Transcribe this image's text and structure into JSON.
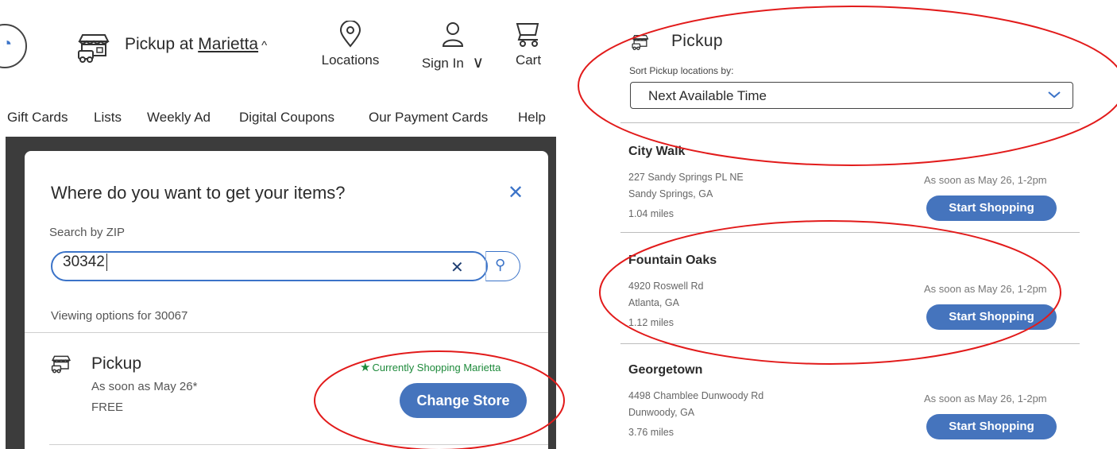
{
  "header": {
    "pickup_prefix": "Pickup at ",
    "pickup_location": "Marietta",
    "caret": "^",
    "locations_label": "Locations",
    "signin_label": "Sign In",
    "signin_caret": "∨",
    "cart_label": "Cart"
  },
  "nav": {
    "items": [
      "Gift Cards",
      "Lists",
      "Weekly Ad",
      "Digital Coupons",
      "Our Payment Cards",
      "Help"
    ]
  },
  "modal": {
    "title": "Where do you want to get your items?",
    "close": "✕",
    "zip_label": "Search by ZIP",
    "zip_value": "30342",
    "zip_clear": "✕",
    "viewing_text": "Viewing options for 30067",
    "option": {
      "title": "Pickup",
      "soon": "As soon as May 26*",
      "price": "FREE",
      "current": "Currently Shopping Marietta",
      "change_label": "Change Store"
    }
  },
  "right": {
    "title": "Pickup",
    "sort_label": "Sort Pickup locations by:",
    "sort_value": "Next Available Time",
    "stores": [
      {
        "name": "City Walk",
        "address1": "227 Sandy Springs PL NE",
        "address2": "Sandy Springs, GA",
        "distance": "1.04 miles",
        "time": "As soon as May 26, 1-2pm",
        "button": "Start Shopping"
      },
      {
        "name": "Fountain Oaks",
        "address1": "4920 Roswell Rd",
        "address2": "Atlanta, GA",
        "distance": "1.12 miles",
        "time": "As soon as May 26, 1-2pm",
        "button": "Start Shopping"
      },
      {
        "name": "Georgetown",
        "address1": "4498 Chamblee Dunwoody Rd",
        "address2": "Dunwoody, GA",
        "distance": "3.76 miles",
        "time": "As soon as May 26, 1-2pm",
        "button": "Start Shopping"
      }
    ]
  },
  "colors": {
    "accent_blue": "#4574bd",
    "success_green": "#1e8a3b",
    "annotation_red": "#e21b1b",
    "overlay_dark": "#3c3c3c"
  },
  "icons": [
    "search-icon",
    "store-icon",
    "location-pin-icon",
    "user-icon",
    "cart-icon",
    "close-icon",
    "star-icon",
    "chevron-down-icon"
  ]
}
